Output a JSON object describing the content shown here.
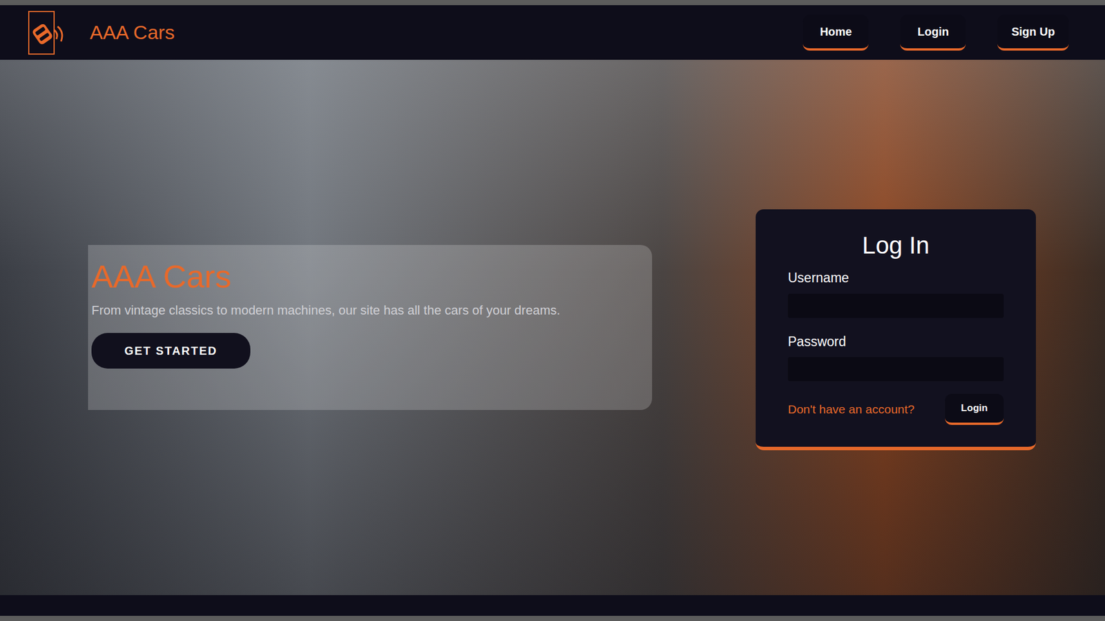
{
  "nav": {
    "brand": "AAA Cars",
    "links": [
      {
        "label": "Home"
      },
      {
        "label": "Login"
      },
      {
        "label": "Sign Up"
      }
    ]
  },
  "hero": {
    "title": "AAA Cars",
    "subtitle": "From vintage classics to modern machines, our site has all the cars of your dreams.",
    "button": "GET STARTED"
  },
  "login": {
    "title": "Log In",
    "fields": [
      {
        "label": "Username",
        "value": ""
      },
      {
        "label": "Password",
        "value": ""
      }
    ],
    "signup_link": "Don't have an account?",
    "button": "Login"
  }
}
